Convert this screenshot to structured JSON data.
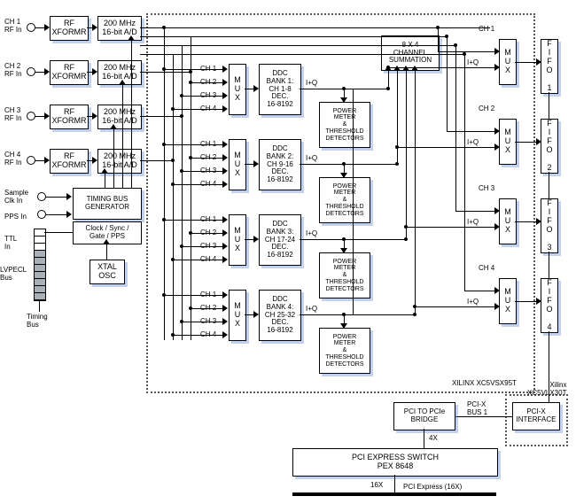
{
  "inputs": {
    "ch_rf": [
      "CH 1\nRF In",
      "CH 2\nRF In",
      "CH 3\nRF In",
      "CH 4\nRF In"
    ],
    "sample_clk": "Sample\nClk In",
    "pps": "PPS In",
    "ttl": "TTL\nIn",
    "lvpecl": "LVPECL\nBus",
    "timing_bus_v": "Timing\nBus"
  },
  "blocks": {
    "rf_xformr": "RF\nXFORMR",
    "adc": "200 MHz\n16-bit A/D",
    "timing_bus_gen": "TIMING BUS\nGENERATOR",
    "timing_sub": "Clock / Sync /\nGate / PPS",
    "xtal": "XTAL\nOSC",
    "mux": "M\nU\nX",
    "mux_in": [
      "CH 1",
      "CH 2",
      "CH 3",
      "CH 4"
    ],
    "ddc": [
      "DDC\nBANK 1:\nCH 1-8\nDEC.\n16-8192",
      "DDC\nBANK 2:\nCH 9-16\nDEC.\n16-8192",
      "DDC\nBANK 3:\nCH 17-24\nDEC.\n16-8192",
      "DDC\nBANK 4:\nCH 25-32\nDEC.\n16-8192"
    ],
    "iq": "I+Q",
    "power_meter": "POWER\nMETER\n&\nTHRESHOLD\nDETECTORS",
    "summation": "8 X 4\nCHANNEL\nSUMMATION",
    "out_ch": [
      "CH 1",
      "CH 2",
      "CH 3",
      "CH 4"
    ],
    "fifo": [
      "F\nI\nF\nO\n\n1",
      "F\nI\nF\nO\n\n2",
      "F\nI\nF\nO\n\n3",
      "F\nI\nF\nO\n\n4"
    ],
    "fpga_main": "XILINX XC5VSX95T",
    "fpga_side": "Xilinx\nXC5VLX30T",
    "pcix_if": "PCI-X\nINTERFACE",
    "pci_bridge": "PCI TO PCIe\nBRIDGE",
    "pci_switch": "PCI EXPRESS SWITCH\nPEX 8648",
    "pcix_bus": "PCI-X\nBUS 1",
    "lane4": "4X",
    "lane16": "16X",
    "pcie16": "PCI Express (16X)"
  }
}
